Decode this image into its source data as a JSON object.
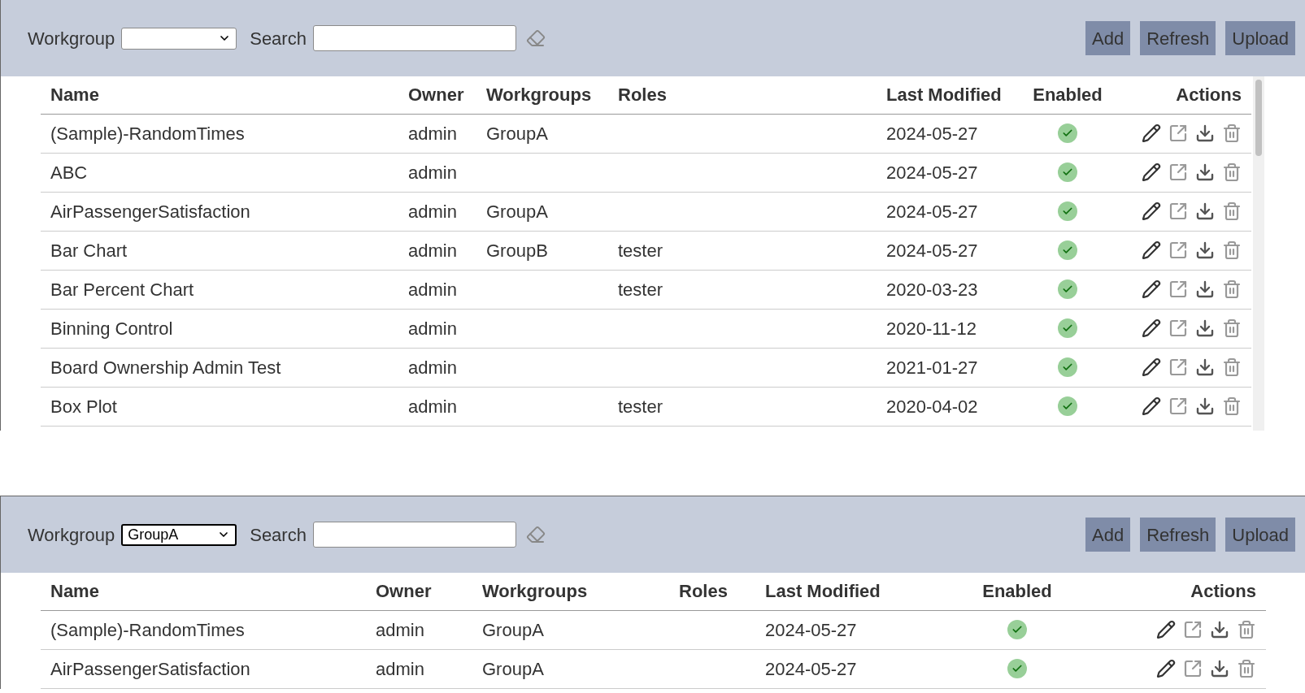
{
  "panels": [
    {
      "toolbar": {
        "workgroup_label": "Workgroup",
        "workgroup_focused": false,
        "search_label": "Search",
        "buttons": [
          "Add",
          "Refresh",
          "Upload"
        ]
      },
      "table": {
        "columns": [
          "Name",
          "Owner",
          "Workgroups",
          "Roles",
          "Last Modified",
          "Enabled",
          "Actions"
        ],
        "rows": [
          {
            "name": "(Sample)-RandomTimes",
            "owner": "admin",
            "workgroups": "GroupA",
            "last_modified": "2024-05-27",
            "enabled": true
          },
          {
            "name": "ABC",
            "owner": "admin",
            "last_modified": "2024-05-27",
            "enabled": true
          },
          {
            "name": "AirPassengerSatisfaction",
            "owner": "admin",
            "workgroups": "GroupA",
            "last_modified": "2024-05-27",
            "enabled": true
          },
          {
            "name": "Bar Chart",
            "owner": "admin",
            "workgroups": "GroupB",
            "roles": "tester",
            "last_modified": "2024-05-27",
            "enabled": true
          },
          {
            "name": "Bar Percent Chart",
            "owner": "admin",
            "roles": "tester",
            "last_modified": "2020-03-23",
            "enabled": true
          },
          {
            "name": "Binning Control",
            "owner": "admin",
            "last_modified": "2020-11-12",
            "enabled": true
          },
          {
            "name": "Board Ownership Admin Test",
            "owner": "admin",
            "last_modified": "2021-01-27",
            "enabled": true
          },
          {
            "name": "Box Plot",
            "owner": "admin",
            "roles": "tester",
            "last_modified": "2020-04-02",
            "enabled": true
          }
        ]
      }
    },
    {
      "toolbar": {
        "workgroup_label": "Workgroup",
        "workgroup_value": "GroupA",
        "workgroup_focused": true,
        "search_label": "Search",
        "buttons": [
          "Add",
          "Refresh",
          "Upload"
        ]
      },
      "table": {
        "columns": [
          "Name",
          "Owner",
          "Workgroups",
          "Roles",
          "Last Modified",
          "Enabled",
          "Actions"
        ],
        "rows": [
          {
            "name": "(Sample)-RandomTimes",
            "owner": "admin",
            "workgroups": "GroupA",
            "last_modified": "2024-05-27",
            "enabled": true
          },
          {
            "name": "AirPassengerSatisfaction",
            "owner": "admin",
            "workgroups": "GroupA",
            "last_modified": "2024-05-27",
            "enabled": true
          }
        ]
      }
    }
  ]
}
